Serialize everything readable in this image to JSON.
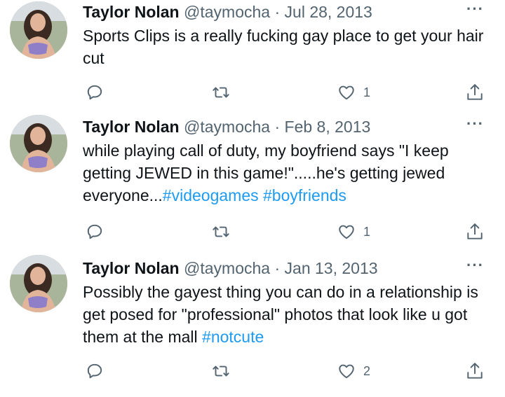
{
  "tweets": [
    {
      "name": "Taylor Nolan",
      "handle": "@taymocha",
      "separator": "·",
      "date": "Jul 28, 2013",
      "more": "···",
      "text": [
        {
          "t": "Sports Clips is a really fucking gay place to get your hair cut",
          "hashtag": false
        }
      ],
      "likes": "1"
    },
    {
      "name": "Taylor Nolan",
      "handle": "@taymocha",
      "separator": "·",
      "date": "Feb 8, 2013",
      "more": "···",
      "text": [
        {
          "t": "while playing call of duty, my boyfriend says \"I keep getting JEWED in this game!\".....he's getting jewed everyone...",
          "hashtag": false
        },
        {
          "t": "#videogames",
          "hashtag": true
        },
        {
          "t": " ",
          "hashtag": false
        },
        {
          "t": "#boyfriends",
          "hashtag": true
        }
      ],
      "likes": "1"
    },
    {
      "name": "Taylor Nolan",
      "handle": "@taymocha",
      "separator": "·",
      "date": "Jan 13, 2013",
      "more": "···",
      "text": [
        {
          "t": "Possibly the gayest thing you can do in a relationship is get posed for \"professional\" photos that look like u got them at the mall ",
          "hashtag": false
        },
        {
          "t": "#notcute",
          "hashtag": true
        }
      ],
      "likes": "2"
    }
  ],
  "colors": {
    "text": "#0f1419",
    "secondary": "#536471",
    "hashtag": "#1d9bf0"
  },
  "icons": [
    "reply-icon",
    "retweet-icon",
    "like-icon",
    "share-icon",
    "more-icon"
  ]
}
